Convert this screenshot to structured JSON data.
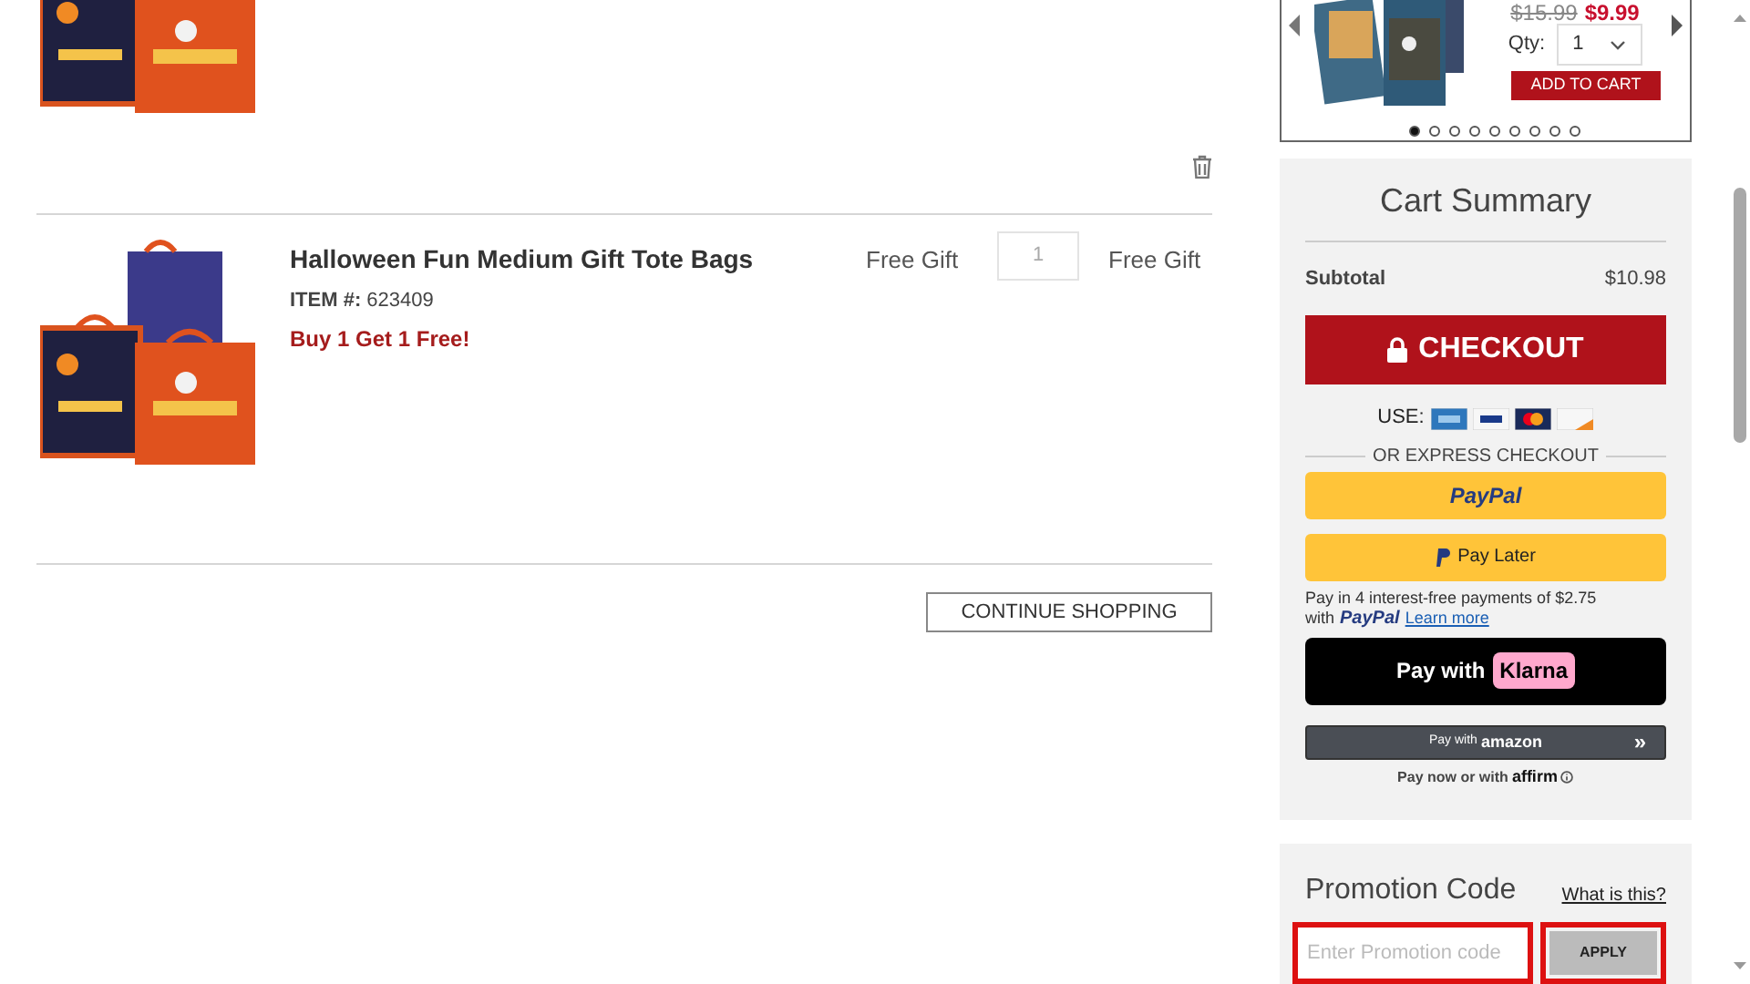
{
  "items": [
    {
      "kind": "partial"
    },
    {
      "kind": "full",
      "name": "Halloween Fun Medium Gift Tote Bags",
      "item_label": "ITEM #:",
      "item_number": "623409",
      "promo": "Buy 1 Get 1 Free!",
      "price": "Free Gift",
      "qty": "1",
      "total": "Free Gift"
    }
  ],
  "continue_button": "CONTINUE SHOPPING",
  "recommendation": {
    "old_price": "$15.99",
    "price": "$9.99",
    "qty_label": "Qty:",
    "qty": "1",
    "button": "ADD TO CART",
    "dots": [
      {
        "selected": true
      },
      {
        "selected": false
      },
      {
        "selected": false
      },
      {
        "selected": false
      },
      {
        "selected": false
      },
      {
        "selected": false
      },
      {
        "selected": false
      },
      {
        "selected": false
      },
      {
        "selected": false
      }
    ]
  },
  "summary": {
    "title": "Cart Summary",
    "subtotal_label": "Subtotal",
    "subtotal": "$10.98",
    "checkout": "CHECKOUT",
    "use_label": "USE:",
    "express_label": "OR EXPRESS CHECKOUT",
    "paypal": "PayPal",
    "pay_later": "Pay Later",
    "pay_later_note": "Pay in 4 interest-free payments of $2.75",
    "with": "with",
    "paypal_small": "PayPal",
    "learn_more": "Learn more",
    "klarna_prefix": "Pay with",
    "klarna": "Klarna",
    "amazon_prefix": "Pay with",
    "amazon": "amazon",
    "amazon_arrows": "»",
    "affirm_prefix": "Pay now or with",
    "affirm": "affirm"
  },
  "promo": {
    "title": "Promotion Code",
    "link": "What is this?",
    "placeholder": "Enter Promotion code",
    "button": "APPLY"
  }
}
